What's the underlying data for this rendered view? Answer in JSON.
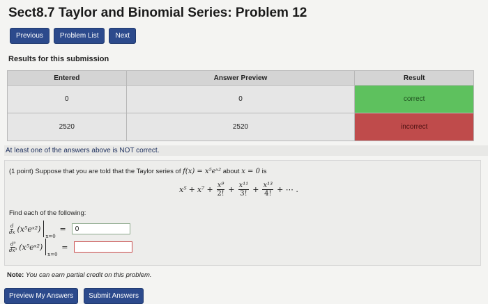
{
  "title": "Sect8.7 Taylor and Binomial Series: Problem 12",
  "nav": {
    "previous": "Previous",
    "problem_list": "Problem List",
    "next": "Next"
  },
  "results_heading": "Results for this submission",
  "results_table": {
    "headers": [
      "Entered",
      "Answer Preview",
      "Result"
    ],
    "rows": [
      {
        "entered": "0",
        "preview": "0",
        "result": "correct"
      },
      {
        "entered": "2520",
        "preview": "2520",
        "result": "incorrect"
      }
    ]
  },
  "warning": "At least one of the answers above is NOT correct.",
  "problem": {
    "points": "(1 point)",
    "intro": "Suppose that you are told that the Taylor series of",
    "function": "f(x) = x⁵eˣ²",
    "about": "about",
    "about_point": "x = 0",
    "is_word": "is",
    "series": {
      "term1": "x⁵",
      "term2": "x⁷",
      "term3_num": "x⁹",
      "term3_den": "2!",
      "term4_num": "x¹¹",
      "term4_den": "3!",
      "term5_num": "x¹³",
      "term5_den": "4!",
      "tail": "+ ⋯ ."
    },
    "find": "Find each of the following:",
    "q1": {
      "op_num": "d",
      "op_den": "dx",
      "expr": "(x⁵eˣ²)",
      "at": "x=0",
      "eq": "=",
      "value": "0"
    },
    "q2": {
      "op_num": "d⁹",
      "op_den": "dx⁹",
      "expr": "(x⁵eˣ²)",
      "at": "x=0",
      "eq": "=",
      "value": ""
    }
  },
  "note": {
    "label": "Note:",
    "text": "You can earn partial credit on this problem."
  },
  "buttons": {
    "preview": "Preview My Answers",
    "submit": "Submit Answers"
  }
}
